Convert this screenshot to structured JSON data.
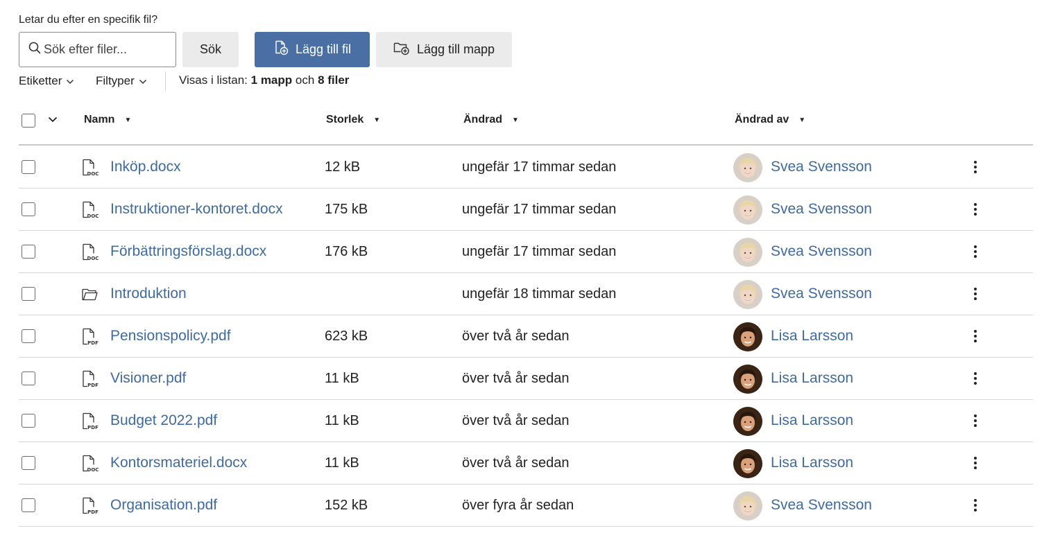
{
  "search": {
    "label": "Letar du efter en specifik fil?",
    "placeholder": "Sök efter filer...",
    "value": "",
    "button_label": "Sök"
  },
  "actions": {
    "add_file_label": "Lägg till fil",
    "add_folder_label": "Lägg till mapp"
  },
  "filters": {
    "tags_label": "Etiketter",
    "types_label": "Filtyper"
  },
  "summary": {
    "prefix": "Visas i listan:",
    "folders": "1 mapp",
    "conjunction": "och",
    "files": "8 filer"
  },
  "table": {
    "columns": {
      "name": "Namn",
      "size": "Storlek",
      "modified": "Ändrad",
      "modified_by": "Ändrad av"
    },
    "rows": [
      {
        "type": "doc",
        "name": "Inköp.docx",
        "size": "12 kB",
        "modified": "ungefär 17 timmar sedan",
        "modified_by": "Svea Svensson",
        "avatar": "blonde"
      },
      {
        "type": "doc",
        "name": "Instruktioner-kontoret.docx",
        "size": "175 kB",
        "modified": "ungefär 17 timmar sedan",
        "modified_by": "Svea Svensson",
        "avatar": "blonde"
      },
      {
        "type": "doc",
        "name": "Förbättringsförslag.docx",
        "size": "176 kB",
        "modified": "ungefär 17 timmar sedan",
        "modified_by": "Svea Svensson",
        "avatar": "blonde"
      },
      {
        "type": "folder",
        "name": "Introduktion",
        "size": "",
        "modified": "ungefär 18 timmar sedan",
        "modified_by": "Svea Svensson",
        "avatar": "blonde"
      },
      {
        "type": "pdf",
        "name": "Pensionspolicy.pdf",
        "size": "623 kB",
        "modified": "över två år sedan",
        "modified_by": "Lisa Larsson",
        "avatar": "brunette"
      },
      {
        "type": "pdf",
        "name": "Visioner.pdf",
        "size": "11 kB",
        "modified": "över två år sedan",
        "modified_by": "Lisa Larsson",
        "avatar": "brunette"
      },
      {
        "type": "pdf",
        "name": "Budget 2022.pdf",
        "size": "11 kB",
        "modified": "över två år sedan",
        "modified_by": "Lisa Larsson",
        "avatar": "brunette"
      },
      {
        "type": "doc",
        "name": "Kontorsmateriel.docx",
        "size": "11 kB",
        "modified": "över två år sedan",
        "modified_by": "Lisa Larsson",
        "avatar": "brunette"
      },
      {
        "type": "pdf",
        "name": "Organisation.pdf",
        "size": "152 kB",
        "modified": "över fyra år sedan",
        "modified_by": "Svea Svensson",
        "avatar": "blonde"
      }
    ]
  },
  "icons": {
    "search": "search-icon",
    "add_file": "file-plus-icon",
    "add_folder": "folder-plus-icon",
    "chevron": "chevron-down-icon",
    "sort": "sort-down-icon",
    "doc": "doc-file-icon",
    "pdf": "pdf-file-icon",
    "folder": "folder-icon",
    "more": "more-vertical-icon"
  },
  "colors": {
    "primary": "#4a6fa5",
    "link": "#3f6aa0",
    "button_secondary": "#ebebeb",
    "divider": "#d6d6d6"
  }
}
